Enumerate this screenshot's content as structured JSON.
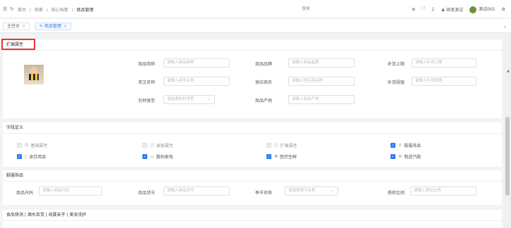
{
  "topbar": {
    "breadcrumb": [
      "首页",
      "/",
      "档案",
      "/",
      "核心档案",
      "/",
      "商品管理"
    ],
    "search_label": "搜索",
    "rd_test": "研发测试",
    "user": "测试001"
  },
  "tabs": [
    {
      "label": "主控台",
      "close": "×"
    },
    {
      "label": "商品管理",
      "close": "×"
    }
  ],
  "ext": {
    "title": "扩展属性",
    "fields": {
      "short_name": {
        "label": "商品简称",
        "placeholder": "请输入商品简称"
      },
      "brand": {
        "label": "商品品牌",
        "placeholder": "请输入商品品牌"
      },
      "reorder_max": {
        "label": "补货上限",
        "placeholder": "请输入补货上限"
      },
      "en_name": {
        "label": "英文名称",
        "placeholder": "请输入英文名称"
      },
      "supplier": {
        "label": "供应商名",
        "placeholder": "请输入供应商名称"
      },
      "reorder_threshold": {
        "label": "补货阈值",
        "placeholder": "请输入补货阈值"
      },
      "packing": {
        "label": "包材类型",
        "placeholder": "请选择包材类型"
      },
      "origin": {
        "label": "商品产地",
        "placeholder": "请输入商品产地"
      }
    }
  },
  "fieldDef": {
    "title": "字段定义",
    "items": [
      {
        "label": "基础属性",
        "icon": "☷",
        "checked": true,
        "disabled": true
      },
      {
        "label": "高级属性",
        "icon": "▢",
        "checked": true,
        "disabled": true
      },
      {
        "label": "扩展属性",
        "icon": "▢",
        "checked": true,
        "disabled": true
      },
      {
        "label": "鞋服饰品",
        "icon": "♔",
        "checked": true,
        "disabled": false
      },
      {
        "label": "食饮用品",
        "icon": "▯",
        "checked": true,
        "disabled": false
      },
      {
        "label": "数码家电",
        "icon": "▭",
        "checked": true,
        "disabled": false
      },
      {
        "label": "医药生鲜",
        "icon": "✚",
        "checked": true,
        "disabled": false
      },
      {
        "label": "制造汽配",
        "icon": "⚙",
        "checked": true,
        "disabled": false
      }
    ]
  },
  "apparel": {
    "title": "鞋服饰品",
    "fields": {
      "size": {
        "label": "商品尺码",
        "placeholder": "请输入商品尺码"
      },
      "sku": {
        "label": "商品货号",
        "placeholder": "请输入商品货号"
      },
      "season": {
        "label": "季节名称",
        "placeholder": "请选择季节名称"
      },
      "qc": {
        "label": "质检比例",
        "placeholder": "请输入质检比例"
      }
    }
  },
  "food": {
    "title": "食品快消 | 酒水百货 | 母婴亲子 | 美妆洗护"
  }
}
